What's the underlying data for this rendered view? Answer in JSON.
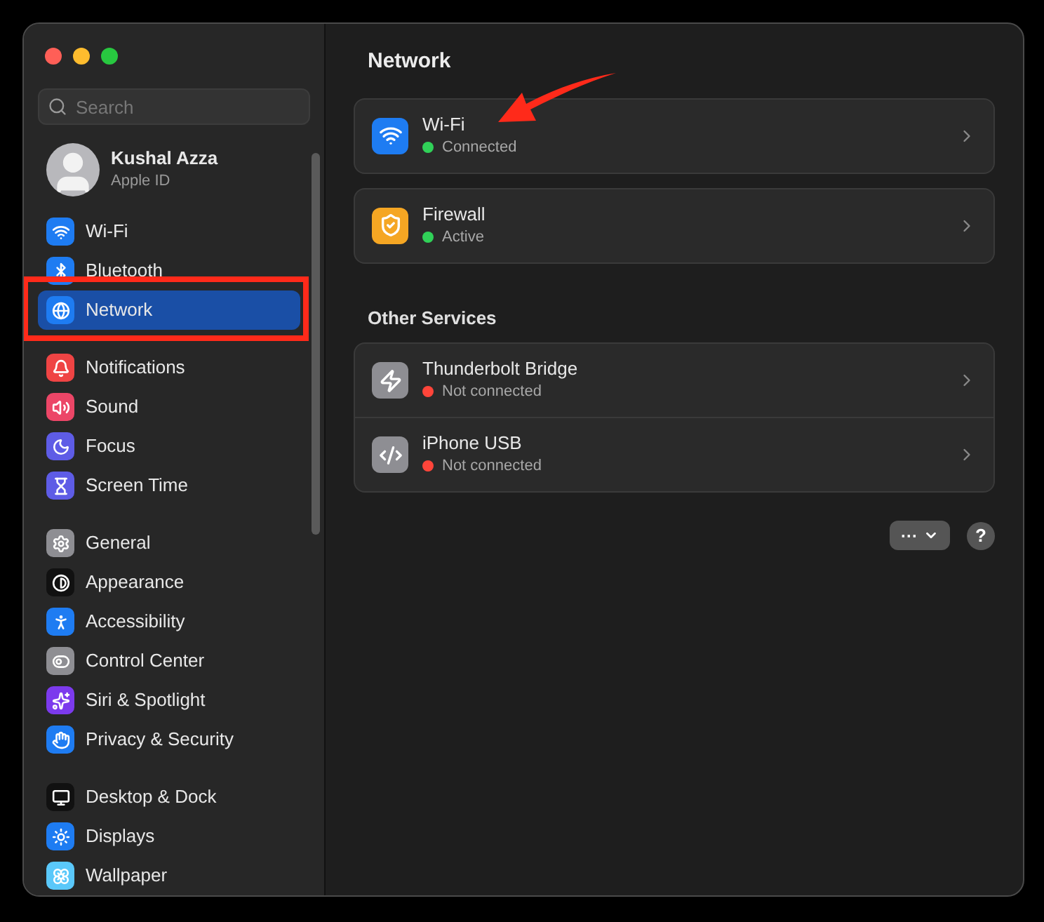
{
  "sidebar": {
    "search": {
      "placeholder": "Search"
    },
    "account": {
      "name": "Kushal Azza",
      "subtitle": "Apple ID"
    },
    "groups": [
      [
        {
          "label": "Wi-Fi",
          "color": "#1e7cf2",
          "selected": false
        },
        {
          "label": "Bluetooth",
          "color": "#1e7cf2",
          "selected": false
        },
        {
          "label": "Network",
          "color": "#1e7cf2",
          "selected": true
        }
      ],
      [
        {
          "label": "Notifications",
          "color": "#ef4444",
          "selected": false
        },
        {
          "label": "Sound",
          "color": "#ec4667",
          "selected": false
        },
        {
          "label": "Focus",
          "color": "#5e5ce6",
          "selected": false
        },
        {
          "label": "Screen Time",
          "color": "#5e5ce6",
          "selected": false
        }
      ],
      [
        {
          "label": "General",
          "color": "#8e8e93",
          "selected": false
        },
        {
          "label": "Appearance",
          "color": "#111111",
          "selected": false
        },
        {
          "label": "Accessibility",
          "color": "#1e7cf2",
          "selected": false
        },
        {
          "label": "Control Center",
          "color": "#8e8e93",
          "selected": false
        },
        {
          "label": "Siri & Spotlight",
          "color": "#7c3aed",
          "selected": false
        },
        {
          "label": "Privacy & Security",
          "color": "#1e7cf2",
          "selected": false
        }
      ],
      [
        {
          "label": "Desktop & Dock",
          "color": "#111111",
          "selected": false
        },
        {
          "label": "Displays",
          "color": "#1e7cf2",
          "selected": false
        },
        {
          "label": "Wallpaper",
          "color": "#5ac8fa",
          "selected": false
        }
      ]
    ]
  },
  "main": {
    "title": "Network",
    "services": [
      {
        "name": "Wi-Fi",
        "status": "Connected",
        "color": "#30d158"
      },
      {
        "name": "Firewall",
        "status": "Active",
        "color": "#30d158"
      }
    ],
    "other_title": "Other Services",
    "other_services": [
      {
        "name": "Thunderbolt Bridge",
        "status": "Not connected",
        "color": "#ff453a"
      },
      {
        "name": "iPhone USB",
        "status": "Not connected",
        "color": "#ff453a"
      }
    ],
    "more_button": "···",
    "help_button": "?"
  }
}
